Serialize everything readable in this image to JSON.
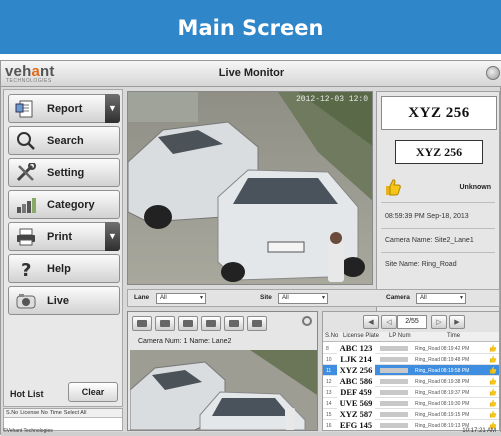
{
  "banner": {
    "title": "Main Screen"
  },
  "window": {
    "logo_text_a": "veh",
    "logo_text_o": "a",
    "logo_text_b": "nt",
    "logo_sub": "TECHNOLOGIES",
    "title": "Live Monitor"
  },
  "sidebar": {
    "items": [
      {
        "label": "Report",
        "icon": "report-icon",
        "has_dropdown": true
      },
      {
        "label": "Search",
        "icon": "search-icon",
        "has_dropdown": false
      },
      {
        "label": "Setting",
        "icon": "tools-icon",
        "has_dropdown": false
      },
      {
        "label": "Category",
        "icon": "category-icon",
        "has_dropdown": false
      },
      {
        "label": "Print",
        "icon": "printer-icon",
        "has_dropdown": true
      },
      {
        "label": "Help",
        "icon": "question-icon",
        "has_dropdown": false
      },
      {
        "label": "Live",
        "icon": "camera-icon",
        "has_dropdown": false
      }
    ],
    "hotlist_label": "Hot List",
    "clear_label": "Clear"
  },
  "hotlist_table": {
    "columns": [
      "S.No",
      "License No",
      "Time",
      "Select All"
    ]
  },
  "camera_main": {
    "timestamp": "2012-12-03 12:0"
  },
  "info_panel": {
    "plate_large": "XYZ 256",
    "plate_small": "XYZ 256",
    "status": "Unknown",
    "datetime": "08:59:39 PM Sep-18, 2013",
    "camera_name": "Camera Name: Site2_Lane1",
    "site_name": "Site Name: Ring_Road"
  },
  "filters": {
    "lane_label": "Lane",
    "lane_value": "All",
    "site_label": "Site",
    "site_value": "All",
    "camera_label": "Camera",
    "camera_value": "All"
  },
  "camera_secondary": {
    "caption": "Camera Num: 1 Name: Lane2"
  },
  "records": {
    "page_count": "2/55",
    "columns": [
      "S.No",
      "License Plate",
      "LP Num",
      "Time"
    ],
    "rows": [
      {
        "sno": "8",
        "plate": "ABC 123",
        "site": "Ring_Road",
        "time": "08:19:42 PM",
        "selected": false
      },
      {
        "sno": "10",
        "plate": "LJK 214",
        "site": "Ring_Road",
        "time": "08:19:48 PM",
        "selected": false
      },
      {
        "sno": "11",
        "plate": "XYZ 256",
        "site": "Ring_Road",
        "time": "08:19:58 PM",
        "selected": true
      },
      {
        "sno": "12",
        "plate": "ABC 586",
        "site": "Ring_Road",
        "time": "08:19:38 PM",
        "selected": false
      },
      {
        "sno": "13",
        "plate": "DEF 459",
        "site": "Ring_Road",
        "time": "08:19:37 PM",
        "selected": false
      },
      {
        "sno": "14",
        "plate": "UVE 569",
        "site": "Ring_Road",
        "time": "08:19:30 PM",
        "selected": false
      },
      {
        "sno": "15",
        "plate": "XYZ 587",
        "site": "Ring_Road",
        "time": "08:19:15 PM",
        "selected": false
      },
      {
        "sno": "16",
        "plate": "EFG 145",
        "site": "Ring_Road",
        "time": "08:19:13 PM",
        "selected": false
      }
    ]
  },
  "statusbar": {
    "left": "©Vehant Technologies",
    "right": "10:17:21 AM"
  },
  "colors": {
    "banner": "#2f86c9",
    "selected_row": "#3d8ee0",
    "logo_accent": "#e06a1b"
  }
}
